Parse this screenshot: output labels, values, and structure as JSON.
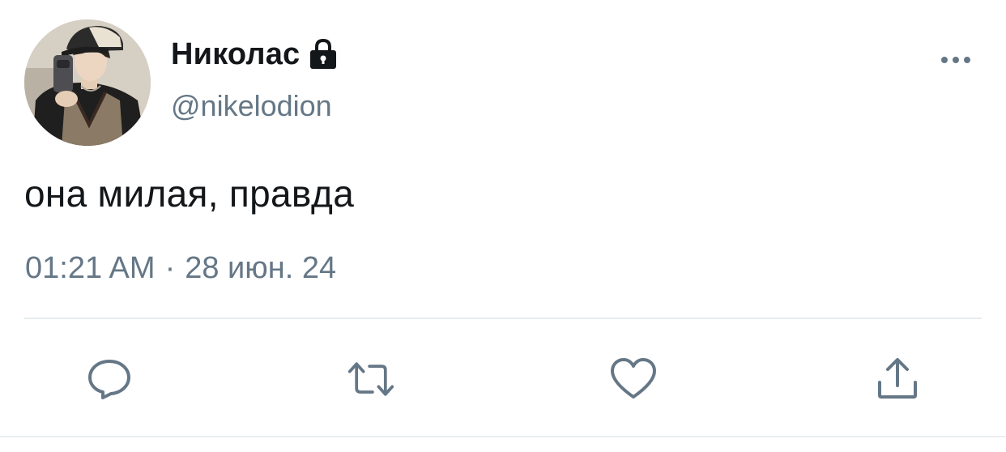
{
  "user": {
    "display_name": "Николас",
    "handle": "@nikelodion",
    "protected": true,
    "avatar_icon": "profile-photo",
    "lock_icon": "lock-icon"
  },
  "tweet": {
    "text": "она милая, правда",
    "time": "01:21 AM",
    "separator": "·",
    "date": "28 июн. 24"
  },
  "actions": [
    {
      "name": "reply",
      "icon": "reply-icon"
    },
    {
      "name": "retweet",
      "icon": "retweet-icon"
    },
    {
      "name": "like",
      "icon": "heart-icon"
    },
    {
      "name": "share",
      "icon": "share-icon"
    }
  ],
  "colors": {
    "text_primary": "#14171a",
    "text_secondary": "#657786",
    "divider": "#e6ecf0"
  }
}
